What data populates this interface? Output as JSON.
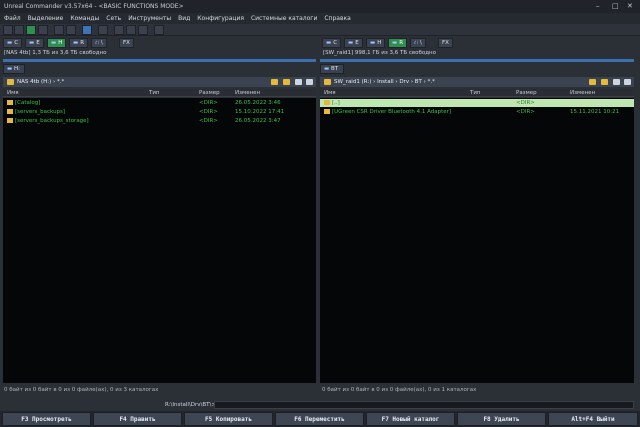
{
  "window": {
    "title": "Unreal Commander v3.57x64 - <BASIC FUNCTIONS MODE>",
    "controls": [
      "–",
      "□",
      "✕"
    ]
  },
  "menu": [
    "Файл",
    "Выделение",
    "Команды",
    "Сеть",
    "Инструменты",
    "Вид",
    "Конфигурация",
    "Системные каталоги",
    "Справка"
  ],
  "left": {
    "drives": [
      "C",
      "E",
      "H",
      "R",
      "FX"
    ],
    "active_drive": "H",
    "space_info": "[NAS 4tb]  1,3 ТБ из 3,6 ТБ свободно",
    "tab": "H:",
    "path": "NAS 4tb (H:)  ›  *.*",
    "columns": {
      "name": "Имя",
      "type": "Тип",
      "size": "Размер",
      "date": "Изменен"
    },
    "rows": [
      {
        "name": "[Catalog]",
        "size": "<DIR>",
        "date": "26.05.2022 3:46"
      },
      {
        "name": "[servers_backups]",
        "size": "<DIR>",
        "date": "15.10.2022 17:41"
      },
      {
        "name": "[servers_backups_storage]",
        "size": "<DIR>",
        "date": "26.05.2022 3:47"
      }
    ],
    "status": "0 байт из 0 байт в 0 из 0 файле(ах), 0 из 3 каталогах"
  },
  "right": {
    "drives": [
      "C",
      "E",
      "H",
      "R",
      "FX"
    ],
    "active_drive": "R",
    "space_info": "[SW_raid1]  998,1 ГБ из 3,6 ТБ свободно",
    "tab": "BT",
    "path": "SW_raid1 (R:)  ›  Install  ›  Drv  ›  BT  ›  *.*",
    "columns": {
      "name": "Имя",
      "type": "Тип",
      "size": "Размер",
      "date": "Изменен"
    },
    "rows": [
      {
        "name": "[..]",
        "size": "<DIR>",
        "date": "",
        "selected": true
      },
      {
        "name": "[UGreen CSR Driver Bluetooth 4.1 Adapter]",
        "size": "<DIR>",
        "date": "15.11.2021 10:21"
      }
    ],
    "status": "0 байт из 0 байт в 0 из 0 файле(ах), 0 из 1 каталогах"
  },
  "cmdline": {
    "label": "R:\\Install\\Drv\\BT\\>"
  },
  "fkeys": [
    "F3 Просмотреть",
    "F4 Править",
    "F5 Копировать",
    "F6 Переместить",
    "F7 Новый каталог",
    "F8 Удалить",
    "Alt+F4 Выйти"
  ],
  "colors": {
    "accent": "#3d6fb0",
    "dir": "#3fbf4a",
    "selected_row": "#bfe8b0",
    "folder": "#e6b93c"
  }
}
